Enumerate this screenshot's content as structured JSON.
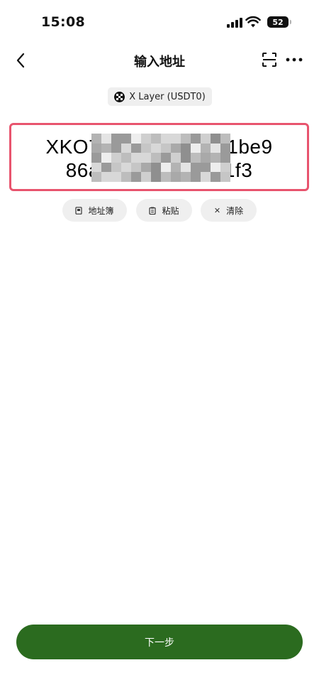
{
  "status_bar": {
    "time": "15:08",
    "battery": "52"
  },
  "nav": {
    "title": "输入地址",
    "back_icon": "chevron-left-icon",
    "scan_icon": "scan-icon",
    "more_icon": "more-horizontal-icon"
  },
  "network": {
    "label": "X Layer (USDT0)",
    "icon": "x-layer-logo-icon"
  },
  "address": {
    "line1_visible": "XKO7c                ob1be9",
    "line2_visible": "86a(                  d1f3",
    "highlight_color": "#e8546e",
    "redacted": true
  },
  "actions": [
    {
      "label": "地址簿",
      "icon": "address-book-icon"
    },
    {
      "label": "粘贴",
      "icon": "clipboard-icon"
    },
    {
      "label": "清除",
      "icon": "clear-x-icon"
    }
  ],
  "footer": {
    "next_label": "下一步",
    "accent_color": "#2b6b1f"
  }
}
